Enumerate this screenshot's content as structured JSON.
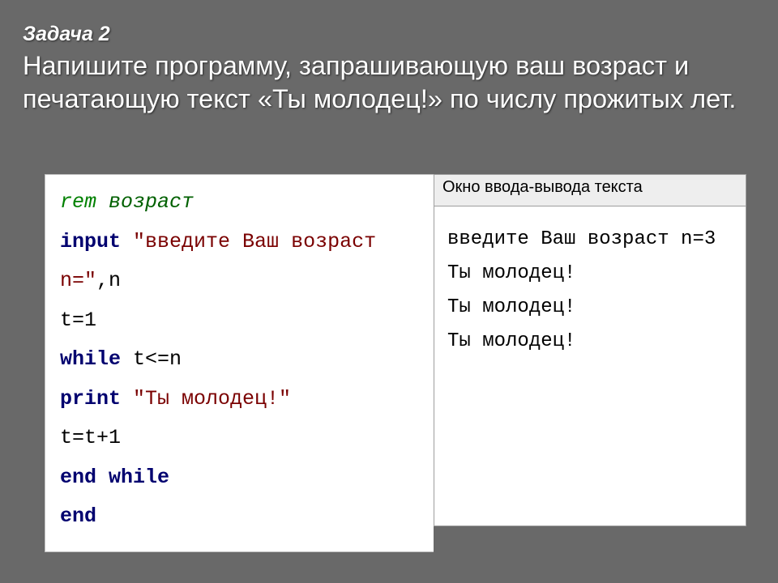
{
  "header": {
    "task_label": "Задача 2",
    "task_text": "Напишите программу, запрашивающую ваш возраст и печатающую текст «Ты молодец!» по числу прожитых лет."
  },
  "code": {
    "line1_kw": "rem",
    "line1_txt": " возраст",
    "line2_kw": "input",
    "line2_sp": " ",
    "line2_str": "\"введите Ваш возраст n=\"",
    "line2_tail": ",n",
    "line3": "t=1",
    "line4_kw": "while",
    "line4_tail": " t<=n",
    "line5_kw": "print",
    "line5_sp": " ",
    "line5_str": "\"Ты молодец!\"",
    "line6": "t=t+1",
    "line7_kw": "end while",
    "line8_kw": "end"
  },
  "output": {
    "title": "Окно ввода-вывода текста",
    "lines": {
      "l1": "введите Ваш возраст n=3",
      "l2": "Ты молодец!",
      "l3": "Ты молодец!",
      "l4": "Ты молодец!"
    }
  }
}
